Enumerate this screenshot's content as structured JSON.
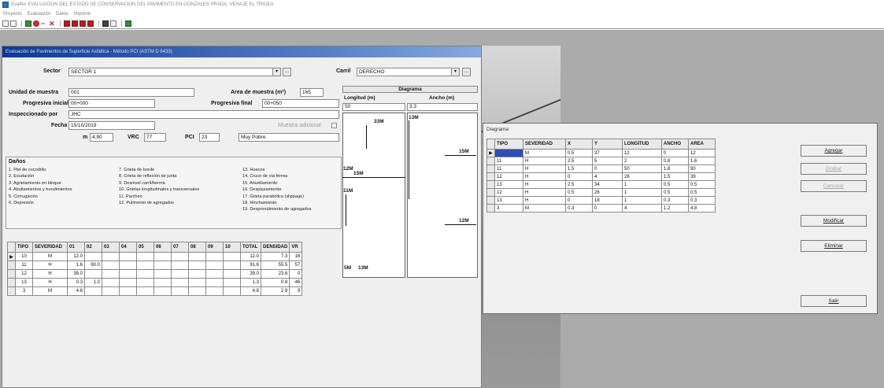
{
  "app": {
    "title": "Evalfec EVALUACION DEL ESTADO DE CONSERVACION DEL PAVIMENTO EN GONZALES PRADA, VENAJE EL TRIGEA",
    "menu": [
      "Proyecto",
      "Evaluación",
      "Datos",
      "Imprimir"
    ]
  },
  "main_window": {
    "caption": "Evaluación de Pavimentos de Superficie Asfáltica - Método PCI (ASTM D 6433)",
    "sector_label": "Sector",
    "sector_value": "SECTOR 1",
    "carril_label": "Carril",
    "carril_value": "DERECHO",
    "unidad_label": "Unidad de muestra",
    "unidad_value": "001",
    "area_label": "Area de muestra (m²)",
    "area_value": "165",
    "prog_inicial_label": "Progresiva inicial",
    "prog_inicial_value": "00+000",
    "prog_final_label": "Progresiva final",
    "prog_final_value": "00+050",
    "inspector_label": "Inspeccionado por",
    "inspector_value": "JHC",
    "fecha_label": "Fecha",
    "fecha_value": "15/10/2019",
    "mostrar_label": "Muestra adicional",
    "m_label": "m",
    "m_value": "4.90",
    "vrc_label": "VRC",
    "vrc_value": "77",
    "pci_label": "PCI",
    "pci_value": "23",
    "condition_value": "Muy Pobre"
  },
  "diagram_panel": {
    "heading": "Diagrama",
    "longitud_label": "Longitud (m)",
    "longitud_value": "50",
    "ancho_label": "Ancho (m)",
    "ancho_value": "3.3",
    "markers": [
      "33M",
      "13M",
      "15M",
      "12M",
      "15M",
      "11M",
      "12M",
      "5M",
      "13M"
    ]
  },
  "danos": {
    "heading": "Daños",
    "col1": [
      "1. Piel de cocodrilo",
      "2. Exudación",
      "3. Agrietamiento en bloque",
      "4. Abultamientos y hundimientos",
      "5. Corrugación",
      "6. Depresión"
    ],
    "col2": [
      "7. Grieta de borde",
      "8. Grieta de reflexión de junta",
      "9. Desnivel carril/berma",
      "10. Grietas longitudinales y transversales",
      "11. Parcheo",
      "12. Pulimento de agregados"
    ],
    "col3": [
      "13. Huecos",
      "14. Cruce de vía férrea",
      "15. Ahuellamiento",
      "16. Desplazamiento",
      "17. Grieta parabólica (slippage)",
      "18. Hinchamiento",
      "19. Desprendimiento de agregados"
    ]
  },
  "main_grid": {
    "headers": [
      "TIPO",
      "SEVERIDAD",
      "01",
      "02",
      "03",
      "04",
      "05",
      "06",
      "07",
      "08",
      "09",
      "10",
      "TOTAL",
      "DENSIDAD",
      "VR"
    ],
    "rows": [
      {
        "cells": [
          "10",
          "M",
          "12.0",
          "",
          "",
          "",
          "",
          "",
          "",
          "",
          "",
          "",
          "12.0",
          "7.3",
          "16"
        ]
      },
      {
        "cells": [
          "11",
          "H",
          "1.6",
          "90.0",
          "",
          "",
          "",
          "",
          "",
          "",
          "",
          "",
          "91.6",
          "55.5",
          "57"
        ]
      },
      {
        "cells": [
          "12",
          "H",
          "39.0",
          "",
          "",
          "",
          "",
          "",
          "",
          "",
          "",
          "",
          "39.0",
          "23.6",
          "0"
        ]
      },
      {
        "cells": [
          "13",
          "H",
          "0.3",
          "1.0",
          "",
          "",
          "",
          "",
          "",
          "",
          "",
          "",
          "1.3",
          "0.8",
          "46"
        ]
      },
      {
        "cells": [
          "3",
          "M",
          "4.8",
          "",
          "",
          "",
          "",
          "",
          "",
          "",
          "",
          "",
          "4.8",
          "2.9",
          "9"
        ]
      }
    ]
  },
  "diagram_dialog": {
    "title": "Diagrama",
    "headers": [
      "TIPO",
      "SEVERIDAD",
      "X",
      "Y",
      "LONGITUD",
      "ANCHO",
      "AREA"
    ],
    "rows": [
      {
        "cells": [
          "",
          "M",
          "0.5",
          "37",
          "12",
          "0",
          "12"
        ]
      },
      {
        "cells": [
          "11",
          "H",
          "2.5",
          "5",
          "2",
          "0.8",
          "1.6"
        ]
      },
      {
        "cells": [
          "11",
          "H",
          "1.5",
          "0",
          "50",
          "1.8",
          "90"
        ]
      },
      {
        "cells": [
          "12",
          "H",
          "0",
          "4",
          "26",
          "1.5",
          "39"
        ]
      },
      {
        "cells": [
          "13",
          "H",
          "2.5",
          "34",
          "1",
          "0.5",
          "0.5"
        ]
      },
      {
        "cells": [
          "12",
          "H",
          "0.5",
          "26",
          "1",
          "0.5",
          "0.5"
        ]
      },
      {
        "cells": [
          "13",
          "H",
          "0",
          "18",
          "1",
          "0.3",
          "0.3"
        ]
      },
      {
        "cells": [
          "3",
          "M",
          "0.3",
          "0",
          "4",
          "1.2",
          "4.8"
        ]
      }
    ],
    "buttons": {
      "agregar": "Agregar",
      "grabar": "Grabar",
      "cancelar": "Cancelar",
      "modificar": "Modificar",
      "eliminar": "Eliminar",
      "salir": "Salir"
    }
  }
}
